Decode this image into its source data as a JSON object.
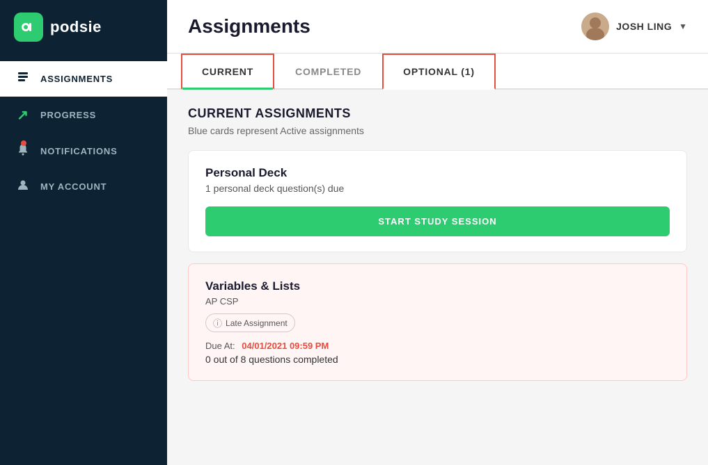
{
  "sidebar": {
    "logo": {
      "icon": "p",
      "text": "podsie"
    },
    "nav_items": [
      {
        "id": "assignments",
        "label": "ASSIGNMENTS",
        "icon": "☰",
        "active": true
      },
      {
        "id": "progress",
        "label": "PROGRESS",
        "icon": "↗",
        "active": false
      },
      {
        "id": "notifications",
        "label": "NOTIFICATIONS",
        "icon": "🔔",
        "active": false,
        "has_dot": true
      },
      {
        "id": "my-account",
        "label": "MY ACCOUNT",
        "icon": "👤",
        "active": false
      }
    ]
  },
  "header": {
    "title": "Assignments",
    "user": {
      "name": "JOSH LING",
      "avatar_initials": "👤"
    }
  },
  "tabs": [
    {
      "id": "current",
      "label": "CURRENT",
      "active": true,
      "highlighted": true
    },
    {
      "id": "completed",
      "label": "COMPLETED",
      "active": false,
      "highlighted": false
    },
    {
      "id": "optional",
      "label": "OPTIONAL (1)",
      "active": false,
      "highlighted": true
    }
  ],
  "main": {
    "section_title": "CURRENT ASSIGNMENTS",
    "section_subtitle": "Blue cards represent Active assignments",
    "cards": [
      {
        "id": "personal-deck",
        "title": "Personal Deck",
        "subtitle": "1 personal deck question(s) due",
        "type": "normal",
        "button_label": "START STUDY SESSION"
      },
      {
        "id": "variables-lists",
        "title": "Variables & Lists",
        "subtitle": "AP CSP",
        "type": "late",
        "badge": "Late Assignment",
        "due_label": "Due At:",
        "due_date": "04/01/2021 09:59 PM",
        "progress": "0 out of 8 questions completed"
      }
    ]
  }
}
